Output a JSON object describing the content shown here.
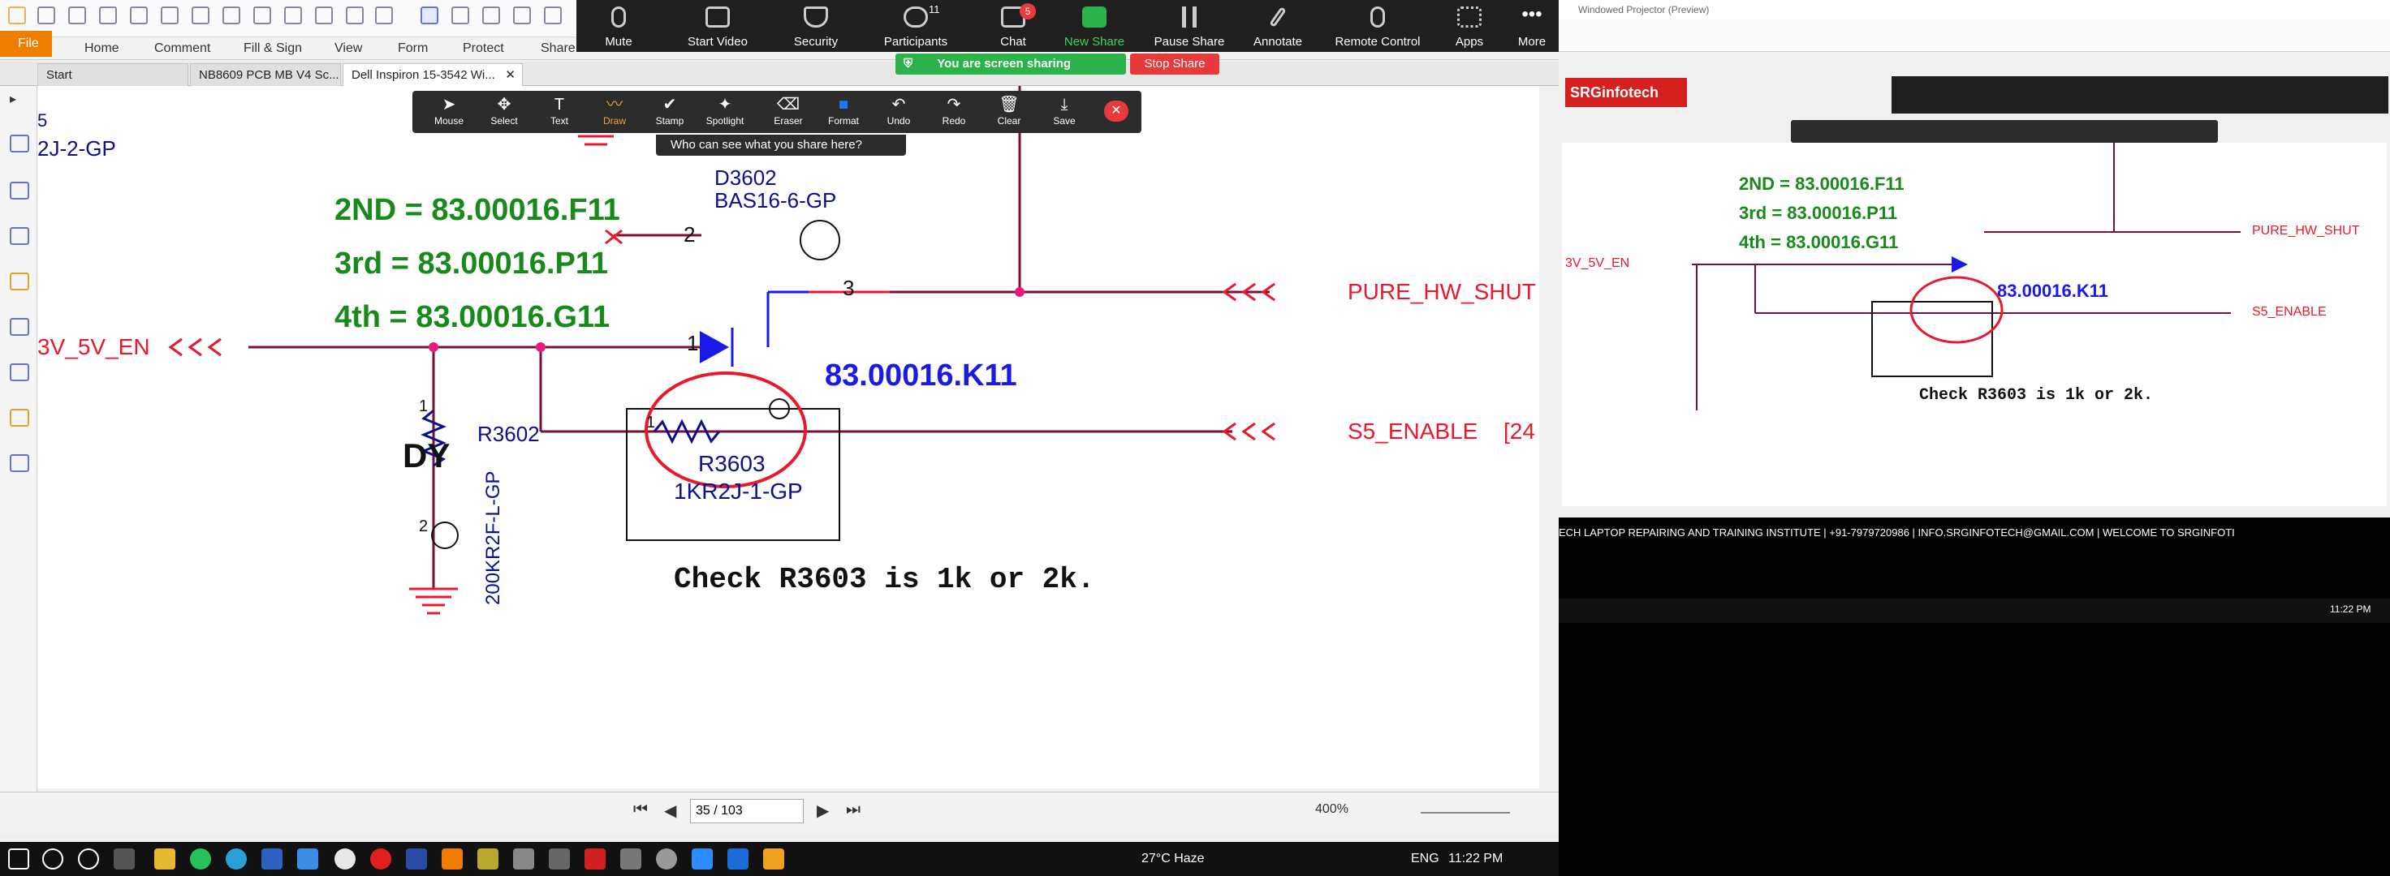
{
  "pdf": {
    "file_label": "File",
    "menus": [
      "Home",
      "Comment",
      "Fill & Sign",
      "View",
      "Form",
      "Protect",
      "Share"
    ],
    "tabs": [
      "Start",
      "NB8609 PCB MB V4 Sc...",
      "Dell Inspiron 15-3542 Wi..."
    ],
    "page": "35 / 103",
    "zoom": "400%"
  },
  "zoom_toolbar": {
    "buttons": [
      {
        "label": "Mute",
        "icon": "microphone-icon"
      },
      {
        "label": "Start Video",
        "icon": "video-off-icon"
      },
      {
        "label": "Security",
        "icon": "shield-icon"
      },
      {
        "label": "Participants",
        "icon": "participants-icon",
        "count": "11"
      },
      {
        "label": "Chat",
        "icon": "chat-icon",
        "badge": "5"
      },
      {
        "label": "New Share",
        "icon": "share-icon"
      },
      {
        "label": "Pause Share",
        "icon": "pause-icon"
      },
      {
        "label": "Annotate",
        "icon": "pen-icon"
      },
      {
        "label": "Remote Control",
        "icon": "mouse-icon"
      },
      {
        "label": "Apps",
        "icon": "apps-icon"
      },
      {
        "label": "More",
        "icon": "more-icon"
      }
    ],
    "sharing_text": "You are screen sharing",
    "stop_share": "Stop Share"
  },
  "annotate": {
    "tools": [
      "Mouse",
      "Select",
      "Text",
      "Draw",
      "Stamp",
      "Spotlight",
      "Eraser",
      "Format",
      "Undo",
      "Redo",
      "Clear",
      "Save"
    ],
    "who_can": "Who can see what you share here?"
  },
  "schematic": {
    "top_left": "5",
    "part_top_left": "2J-2-GP",
    "d_ref": "D3602",
    "d_part": "BAS16-6-GP",
    "note_2nd": "2ND = 83.00016.F11",
    "note_3rd": "3rd = 83.00016.P11",
    "note_4th": "4th = 83.00016.G11",
    "k11": "83.00016.K11",
    "net_left": "3V_5V_EN",
    "net_pure": "PURE_HW_SHUT",
    "net_s5": "S5_ENABLE",
    "s5_suffix": "[24",
    "r3602": "R3602",
    "r3602_part": "200KR2F-L-GP",
    "dy": "DY",
    "r3603": "R3603",
    "r3603_part": "1KR2J-1-GP",
    "pin1": "1",
    "pin2": "2",
    "pin3": "3",
    "check": "Check R3603 is 1k or 2k.",
    "arrows": "< < <"
  },
  "taskbar": {
    "weather": "27°C  Haze",
    "lang": "ENG",
    "time": "11:22 PM",
    "right_time": "11:22 PM"
  },
  "right": {
    "title": "Windowed Projector (Preview)",
    "logo": "SRGinfotech",
    "ticker": "ECH LAPTOP REPAIRING AND TRAINING INSTITUTE   |   +91-7979720986   |   INFO.SRGINFOTECH@GMAIL.COM   |   WELCOME TO SRGINFOTI"
  }
}
